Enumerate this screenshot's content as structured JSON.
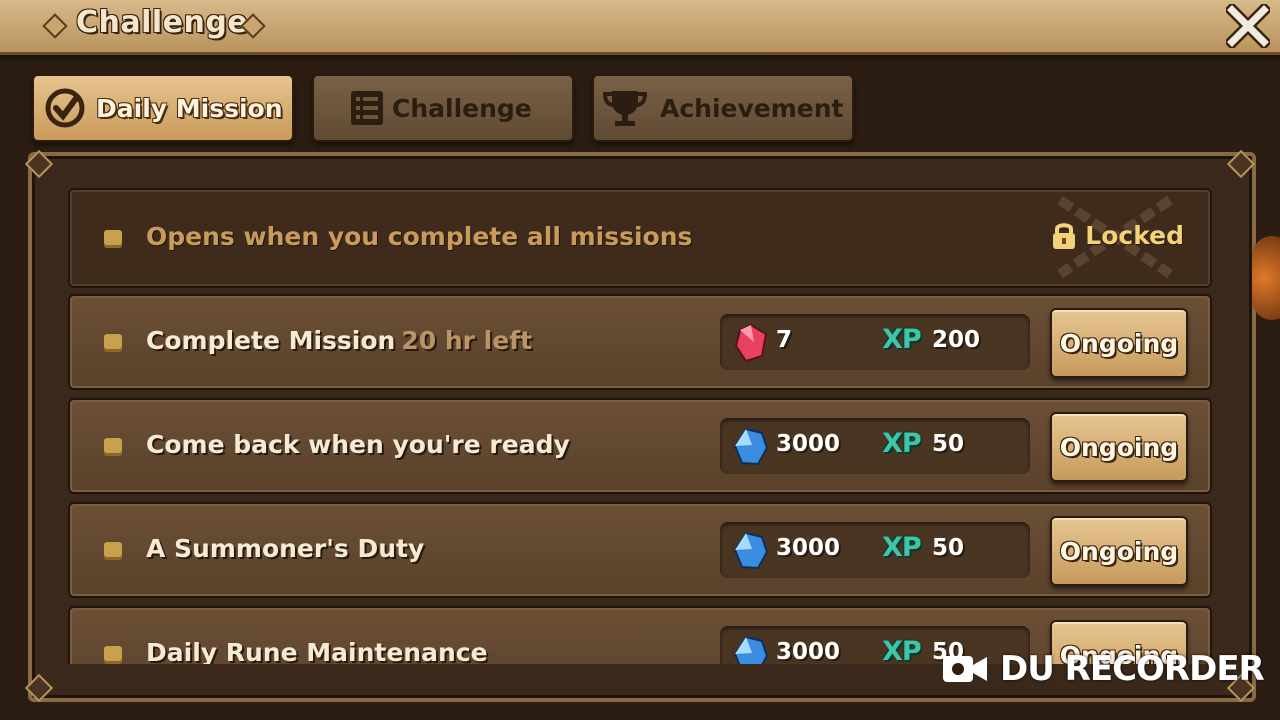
{
  "header": {
    "title": "Challenge"
  },
  "tabs": [
    {
      "label": "Daily Mission",
      "active": true
    },
    {
      "label": "Challenge",
      "active": false
    },
    {
      "label": "Achievement",
      "active": false
    }
  ],
  "locked_row": {
    "text": "Opens when you complete all missions",
    "status": "Locked"
  },
  "missions": [
    {
      "title": "Complete Mission",
      "time_left": "20 hr left",
      "reward_icon": "red-crystal-icon",
      "reward_amount": "7",
      "xp_label": "XP",
      "xp": "200",
      "button": "Ongoing"
    },
    {
      "title": "Come back when you're ready",
      "reward_icon": "blue-crystal-icon",
      "reward_amount": "3000",
      "xp_label": "XP",
      "xp": "50",
      "button": "Ongoing"
    },
    {
      "title": "A Summoner's Duty",
      "reward_icon": "blue-crystal-icon",
      "reward_amount": "3000",
      "xp_label": "XP",
      "xp": "50",
      "button": "Ongoing"
    },
    {
      "title": "Daily Rune Maintenance",
      "reward_icon": "blue-crystal-icon",
      "reward_amount": "3000",
      "xp_label": "XP",
      "xp": "50",
      "button": "Ongoing"
    }
  ],
  "watermark": {
    "text": "DU RECORDER"
  },
  "colors": {
    "accent_gold": "#c99a5a",
    "panel_bg": "#3a281a",
    "xp_teal": "#3fc6a8",
    "locked_gold": "#f3d27a"
  }
}
